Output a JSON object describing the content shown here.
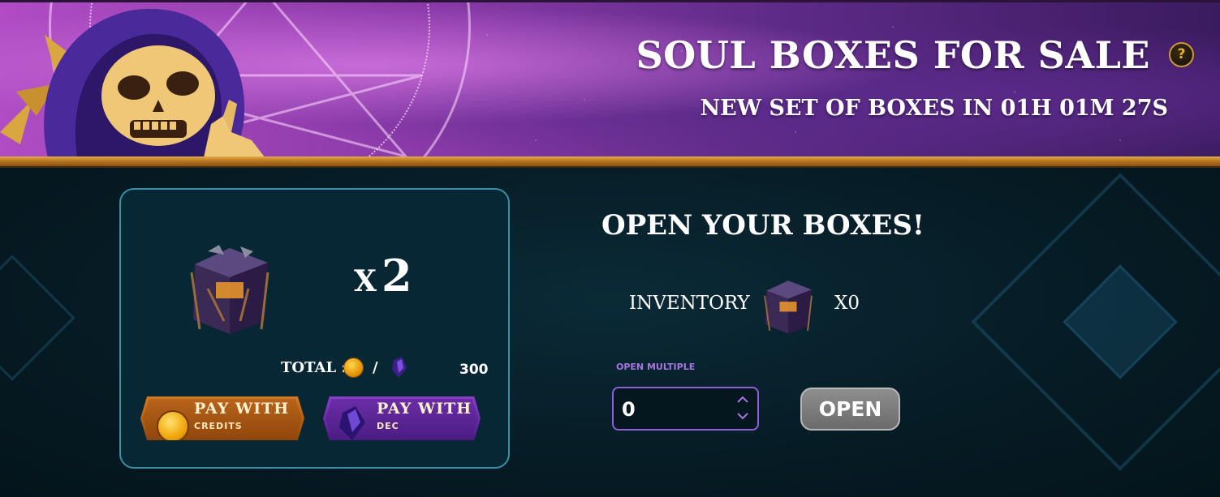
{
  "banner": {
    "title": "SOUL BOXES FOR SALE",
    "help_symbol": "?",
    "timer": "NEW SET OF BOXES IN 01H 01M 27S"
  },
  "purchase": {
    "quantity_prefix": "X",
    "quantity": "2",
    "total_label": "TOTAL :",
    "separator": "/",
    "total_value": "300",
    "pay_credits": {
      "main": "PAY WITH",
      "sub": "CREDITS"
    },
    "pay_dec": {
      "main": "PAY WITH",
      "sub": "DEC"
    }
  },
  "open_section": {
    "title": "OPEN YOUR BOXES!",
    "inventory_label": "INVENTORY",
    "inventory_count": "X0",
    "open_multiple_label": "OPEN MULTIPLE",
    "open_multiple_value": "0",
    "open_button": "OPEN"
  },
  "icons": {
    "mascot": "hooded-skeleton-mascot",
    "box": "soul-box-chest-icon",
    "credits": "credits-coin-icon",
    "dec": "dec-crystal-icon",
    "help": "help-icon"
  },
  "colors": {
    "banner_start": "#b04cc4",
    "banner_end": "#3b1b5f",
    "gold_trim": "#d39a3c",
    "page_bg": "#061b24",
    "card_border": "#3b8ea6",
    "accent_purple": "#8f5fd6",
    "credits_orange": "#c16a18",
    "dec_purple": "#6a2aa8",
    "open_button_grey": "#7b7b7b"
  }
}
